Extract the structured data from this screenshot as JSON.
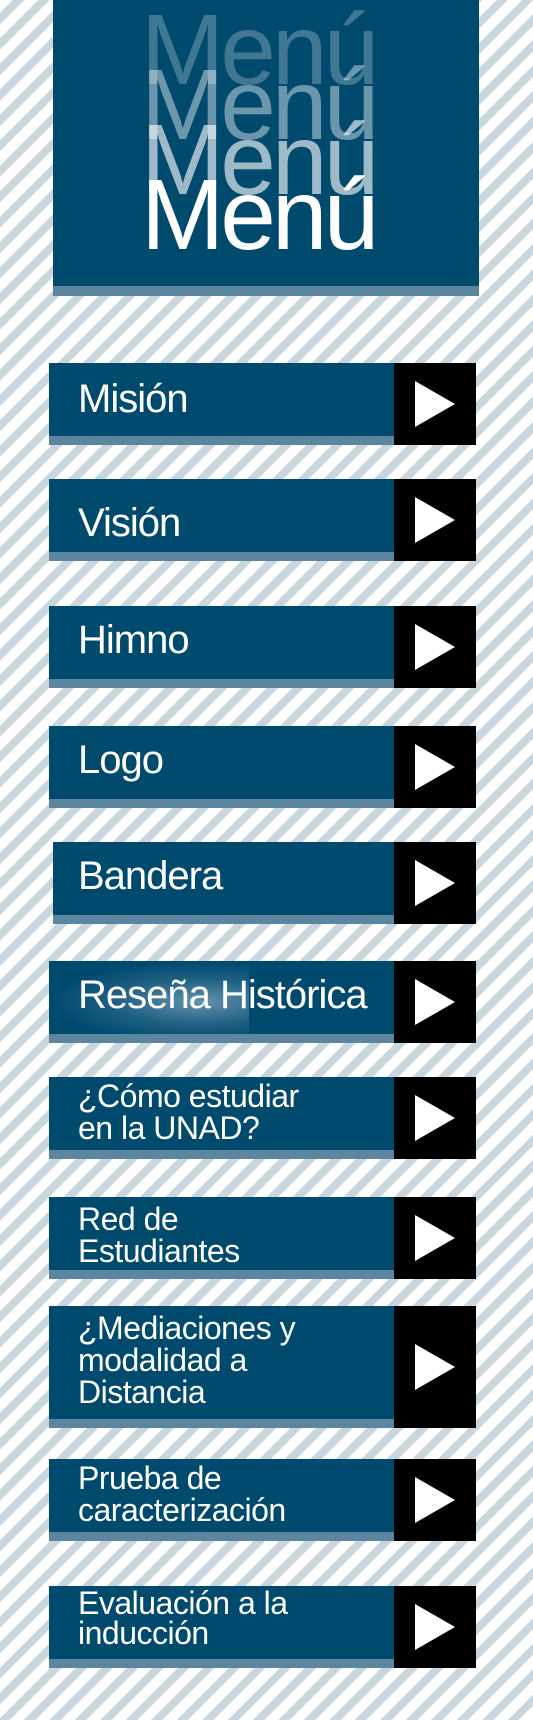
{
  "header": {
    "title": "Menú",
    "colors": {
      "panel": "#004a6e",
      "strip": "#5c86a0",
      "arrow_box": "#000000",
      "text": "#ffffff"
    }
  },
  "menu_items": [
    {
      "label": "Misión"
    },
    {
      "label": "Visión"
    },
    {
      "label": "Himno"
    },
    {
      "label": "Logo"
    },
    {
      "label": "Bandera"
    },
    {
      "label": "Reseña Histórica"
    },
    {
      "label_lines": [
        "¿Cómo estudiar",
        "en la UNAD?"
      ]
    },
    {
      "label_lines": [
        "Red de",
        "Estudiantes"
      ]
    },
    {
      "label_lines": [
        "¿Mediaciones y",
        "modalidad a",
        "Distancia"
      ]
    },
    {
      "label_lines": [
        "Prueba de",
        "caracterización"
      ]
    },
    {
      "label_lines": [
        "Evaluación a la",
        "inducción"
      ]
    }
  ],
  "arrow_icon": "play-triangle-icon"
}
